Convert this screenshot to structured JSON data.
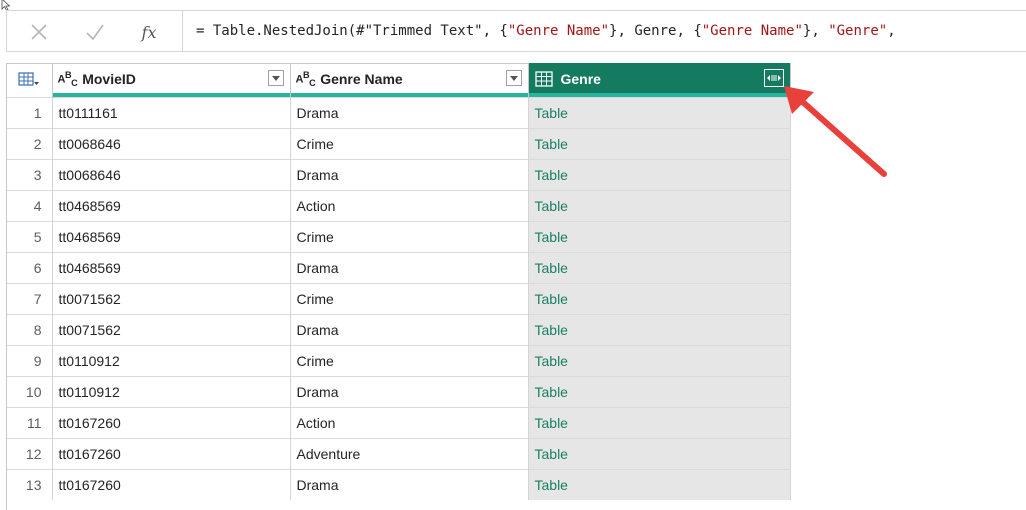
{
  "formula_bar": {
    "cancel_icon": "close-icon",
    "commit_icon": "check-icon",
    "fx_label": "fx",
    "formula": {
      "p1": "= Table.NestedJoin(#\"Trimmed Text\", {",
      "s1": "\"Genre Name\"",
      "p2": "}, Genre, {",
      "s2": "\"Genre Name\"",
      "p3": "}, ",
      "s3": "\"Genre\"",
      "p4": ","
    }
  },
  "table": {
    "columns": [
      {
        "name": "MovieID",
        "type_icon": "A^B_C"
      },
      {
        "name": "Genre Name",
        "type_icon": "A^B_C"
      },
      {
        "name": "Genre",
        "type_icon": "table-icon"
      }
    ],
    "rows": [
      {
        "index": "1",
        "movie_id": "tt0111161",
        "genre_name": "Drama",
        "genre": "Table"
      },
      {
        "index": "2",
        "movie_id": "tt0068646",
        "genre_name": "Crime",
        "genre": "Table"
      },
      {
        "index": "3",
        "movie_id": "tt0068646",
        "genre_name": "Drama",
        "genre": "Table"
      },
      {
        "index": "4",
        "movie_id": "tt0468569",
        "genre_name": "Action",
        "genre": "Table"
      },
      {
        "index": "5",
        "movie_id": "tt0468569",
        "genre_name": "Crime",
        "genre": "Table"
      },
      {
        "index": "6",
        "movie_id": "tt0468569",
        "genre_name": "Drama",
        "genre": "Table"
      },
      {
        "index": "7",
        "movie_id": "tt0071562",
        "genre_name": "Crime",
        "genre": "Table"
      },
      {
        "index": "8",
        "movie_id": "tt0071562",
        "genre_name": "Drama",
        "genre": "Table"
      },
      {
        "index": "9",
        "movie_id": "tt0110912",
        "genre_name": "Crime",
        "genre": "Table"
      },
      {
        "index": "10",
        "movie_id": "tt0110912",
        "genre_name": "Drama",
        "genre": "Table"
      },
      {
        "index": "11",
        "movie_id": "tt0167260",
        "genre_name": "Action",
        "genre": "Table"
      },
      {
        "index": "12",
        "movie_id": "tt0167260",
        "genre_name": "Adventure",
        "genre": "Table"
      },
      {
        "index": "13",
        "movie_id": "tt0167260",
        "genre_name": "Drama",
        "genre": "Table"
      }
    ]
  },
  "colors": {
    "selected_header": "#147a60",
    "quality_bar": "#28b49b",
    "table_link": "#1a7f64",
    "annotation_arrow": "#e8413c"
  }
}
